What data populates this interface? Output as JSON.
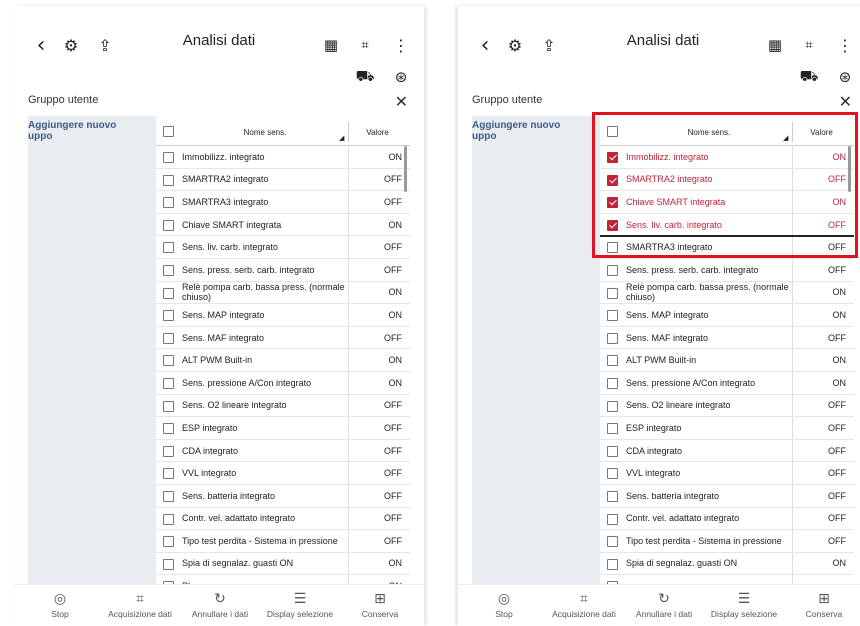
{
  "screens": {
    "left": {
      "title": "Analisi dati",
      "panel_title": "Gruppo utente",
      "sidebar_add": "Aggiungere nuovo uppo",
      "col_name": "Nome sens.",
      "col_value": "Valore",
      "rows": [
        {
          "name": "Immobilizz. integrato",
          "value": "ON",
          "checked": false
        },
        {
          "name": "SMARTRA2 integrato",
          "value": "OFF",
          "checked": false
        },
        {
          "name": "SMARTRA3 integrato",
          "value": "OFF",
          "checked": false
        },
        {
          "name": "Chiave SMART integrata",
          "value": "ON",
          "checked": false
        },
        {
          "name": "Sens. liv. carb. integrato",
          "value": "OFF",
          "checked": false
        },
        {
          "name": "Sens. press. serb. carb. integrato",
          "value": "OFF",
          "checked": false
        },
        {
          "name": "Relè pompa carb. bassa press. (normale chiuso)",
          "value": "ON",
          "checked": false
        },
        {
          "name": "Sens. MAP integrato",
          "value": "ON",
          "checked": false
        },
        {
          "name": "Sens. MAF integrato",
          "value": "OFF",
          "checked": false
        },
        {
          "name": "ALT PWM Built-in",
          "value": "ON",
          "checked": false
        },
        {
          "name": "Sens. pressione A/Con integrato",
          "value": "ON",
          "checked": false
        },
        {
          "name": "Sens. O2 lineare integrato",
          "value": "OFF",
          "checked": false
        },
        {
          "name": "ESP integrato",
          "value": "OFF",
          "checked": false
        },
        {
          "name": "CDA integrato",
          "value": "OFF",
          "checked": false
        },
        {
          "name": "VVL integrato",
          "value": "OFF",
          "checked": false
        },
        {
          "name": "Sens. batteria integrato",
          "value": "OFF",
          "checked": false
        },
        {
          "name": "Contr. vel. adattato integrato",
          "value": "OFF",
          "checked": false
        },
        {
          "name": "Tipo test perdita - Sistema in pressione",
          "value": "OFF",
          "checked": false
        },
        {
          "name": "Spia di segnalaz. guasti ON",
          "value": "ON",
          "checked": false
        },
        {
          "name": "Pl...",
          "value": "ON",
          "checked": false
        }
      ],
      "bottom": [
        "Stop",
        "Acquisizione dati",
        "Annullare i dati",
        "Display selezione",
        "Conserva"
      ]
    },
    "right": {
      "title": "Analisi dati",
      "panel_title": "Gruppo utente",
      "sidebar_add": "Aggiungere nuovo uppo",
      "col_name": "Nome sens.",
      "col_value": "Valore",
      "rows": [
        {
          "name": "Immobilizz. integrato",
          "value": "ON",
          "checked": true
        },
        {
          "name": "SMARTRA2 integrato",
          "value": "OFF",
          "checked": true
        },
        {
          "name": "Chiave SMART integrata",
          "value": "ON",
          "checked": true
        },
        {
          "name": "Sens. liv. carb. integrato",
          "value": "OFF",
          "checked": true
        },
        {
          "name": "SMARTRA3 integrato",
          "value": "OFF",
          "checked": false
        },
        {
          "name": "Sens. press. serb. carb. integrato",
          "value": "OFF",
          "checked": false
        },
        {
          "name": "Relè pompa carb. bassa press. (normale chiuso)",
          "value": "ON",
          "checked": false
        },
        {
          "name": "Sens. MAP integrato",
          "value": "ON",
          "checked": false
        },
        {
          "name": "Sens. MAF integrato",
          "value": "OFF",
          "checked": false
        },
        {
          "name": "ALT PWM Built-in",
          "value": "ON",
          "checked": false
        },
        {
          "name": "Sens. pressione A/Con integrato",
          "value": "ON",
          "checked": false
        },
        {
          "name": "Sens. O2 lineare integrato",
          "value": "OFF",
          "checked": false
        },
        {
          "name": "ESP integrato",
          "value": "OFF",
          "checked": false
        },
        {
          "name": "CDA integrato",
          "value": "OFF",
          "checked": false
        },
        {
          "name": "VVL integrato",
          "value": "OFF",
          "checked": false
        },
        {
          "name": "Sens. batteria integrato",
          "value": "OFF",
          "checked": false
        },
        {
          "name": "Contr. vel. adattato integrato",
          "value": "OFF",
          "checked": false
        },
        {
          "name": "Tipo test perdita - Sistema in pressione",
          "value": "OFF",
          "checked": false
        },
        {
          "name": "Spia di segnalaz. guasti ON",
          "value": "ON",
          "checked": false
        },
        {
          "name": "",
          "value": "",
          "checked": false
        }
      ],
      "bottom": [
        "Stop",
        "Acquisizione dati",
        "Annullare i dati",
        "Display selezione",
        "Conserva"
      ]
    }
  },
  "icons": {
    "back": "chevron-left-icon",
    "engine": "engine-icon",
    "export": "export-icon",
    "calendar": "calendar-icon",
    "expand": "expand-icon",
    "more": "more-vertical-icon",
    "vehicle": "vehicle-icon",
    "gauge": "gauge-icon",
    "close": "close-icon"
  },
  "colors": {
    "selected_text": "#c0243a",
    "highlight_border": "#e0141e",
    "sidebar_bg": "#e9ecf1",
    "sidebar_link": "#3c5a8c"
  }
}
